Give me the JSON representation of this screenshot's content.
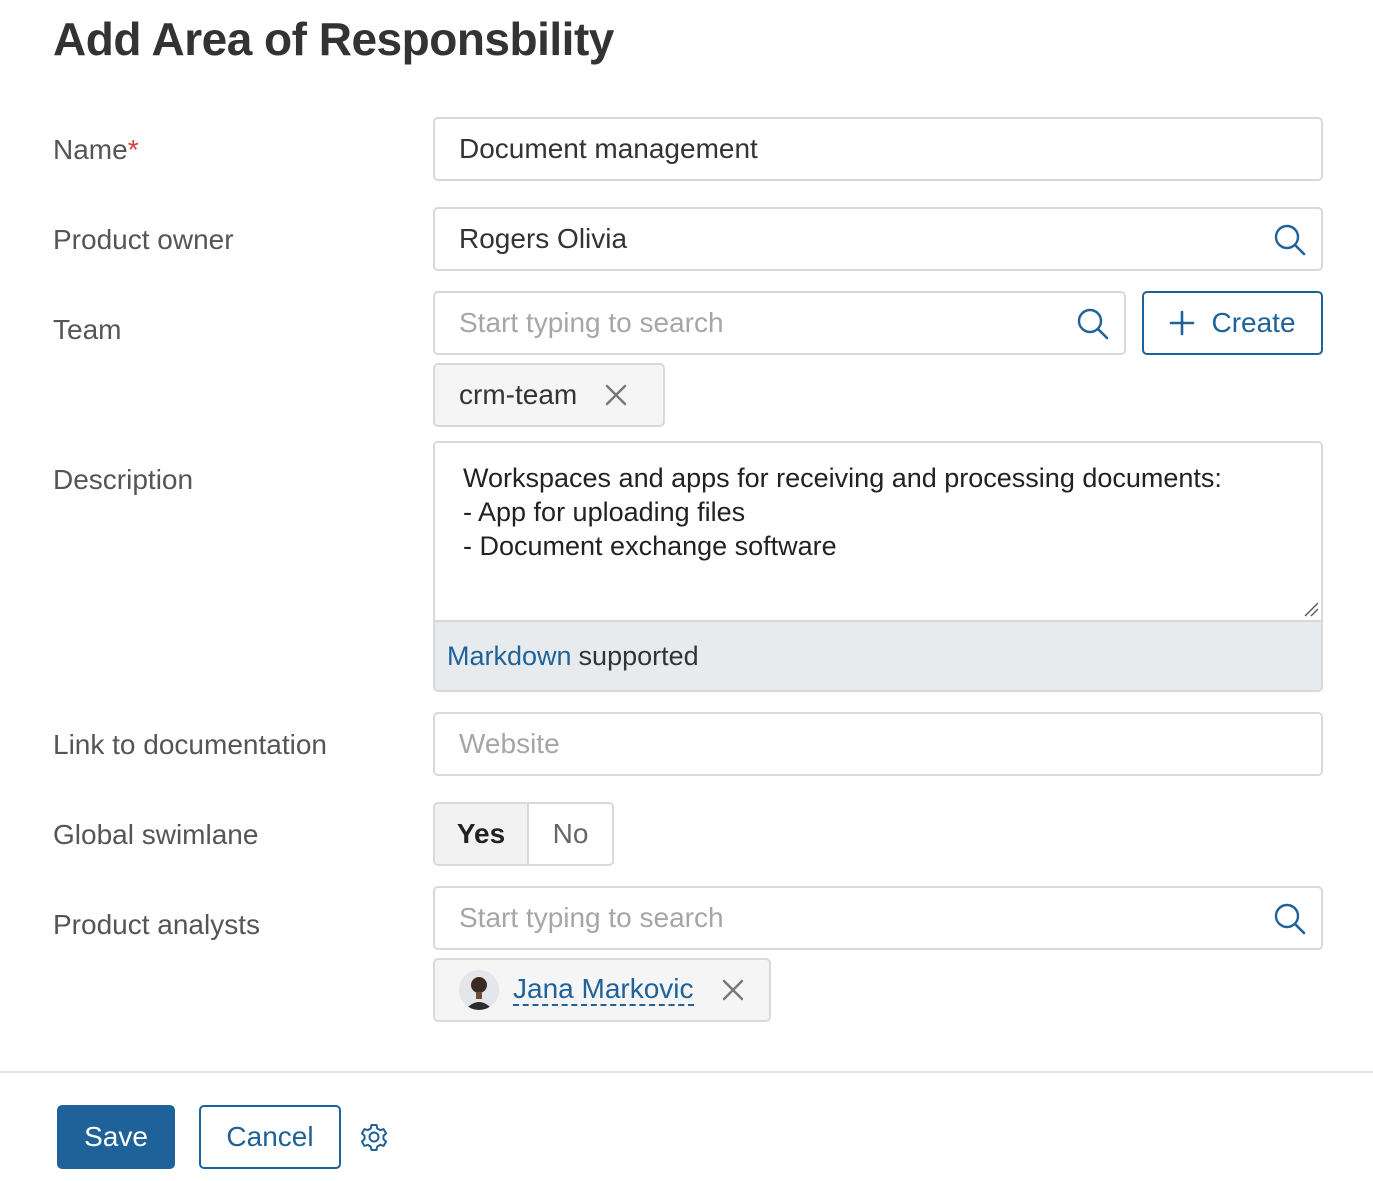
{
  "page": {
    "title": "Add Area of Responsbility"
  },
  "form": {
    "name": {
      "label": "Name",
      "required_mark": "*",
      "value": "Document management"
    },
    "product_owner": {
      "label": "Product owner",
      "value": "Rogers Olivia",
      "icon": "search-icon"
    },
    "team": {
      "label": "Team",
      "placeholder": "Start typing to search",
      "icon": "search-icon",
      "create_label": "Create",
      "tags": [
        "crm-team"
      ]
    },
    "description": {
      "label": "Description",
      "value": "Workspaces and apps for receiving and processing documents:\n- App for uploading files\n- Document exchange software",
      "markdown_link": "Markdown",
      "markdown_suffix": "supported"
    },
    "documentation": {
      "label": "Link to documentation",
      "placeholder": "Website"
    },
    "global_swimlane": {
      "label": "Global swimlane",
      "yes_label": "Yes",
      "no_label": "No",
      "selected": "Yes"
    },
    "product_analysts": {
      "label": "Product analysts",
      "placeholder": "Start typing to search",
      "icon": "search-icon",
      "people": [
        "Jana Markovic"
      ]
    }
  },
  "footer": {
    "save_label": "Save",
    "cancel_label": "Cancel",
    "settings_icon": "gear-icon"
  },
  "colors": {
    "accent": "#1f6299",
    "required": "#d43f3a",
    "border": "#d9d9d9"
  }
}
